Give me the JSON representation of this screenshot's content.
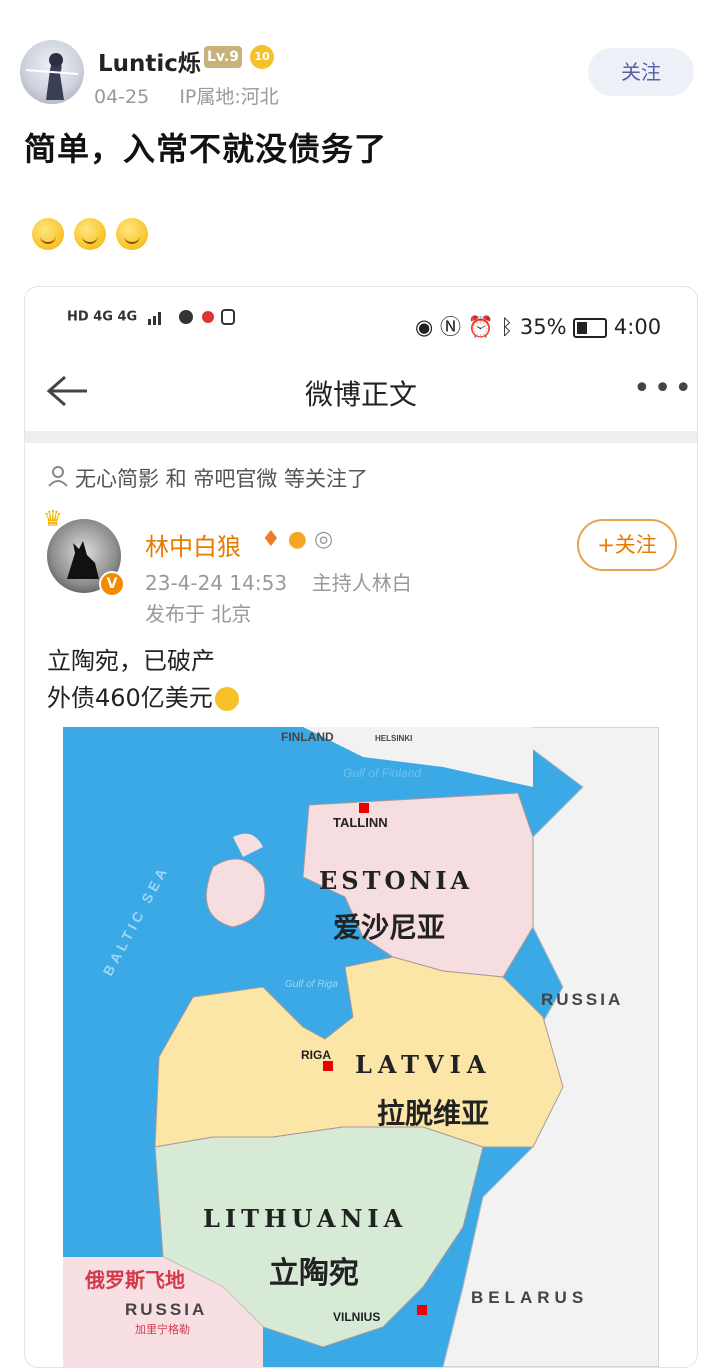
{
  "header": {
    "username": "Luntic烁",
    "level": "Lv.9",
    "medal": "10",
    "date": "04-25",
    "ip": "IP属地:河北",
    "follow_label": "关注"
  },
  "post": {
    "text": "简单，入常不就没债务了"
  },
  "screenshot": {
    "status_left": "HD 4G 4G",
    "battery": "35%",
    "time": "4:00",
    "nav_title": "微博正文",
    "followed_by": "无心简影 和 帝吧官微 等关注了",
    "author": "林中白狼",
    "author_date": "23-4-24 14:53",
    "author_source": "主持人林白",
    "author_location": "发布于 北京",
    "follow_label": "+关注",
    "text_line1": "立陶宛，已破产",
    "text_line2": "外债460亿美元"
  },
  "map": {
    "finland": "FINLAND",
    "helsinki": "HELSINKI",
    "gulf_finland": "Gulf of Finland",
    "baltic": "BALTIC SEA",
    "tallinn": "TALLINN",
    "estonia": "ESTONIA",
    "estonia_cn": "爱沙尼亚",
    "riga": "RIGA",
    "gulf_riga": "Gulf of Riga",
    "latvia": "LATVIA",
    "latvia_cn": "拉脱维亚",
    "russia": "RUSSIA",
    "lithuania": "LITHUANIA",
    "lithuania_cn": "立陶宛",
    "kaliningrad_cn": "俄罗斯飞地",
    "kaliningrad_ru": "RUSSIA",
    "kaliningrad_sub": "加里宁格勒",
    "vilnius": "VILNIUS",
    "belarus": "BELARUS"
  }
}
